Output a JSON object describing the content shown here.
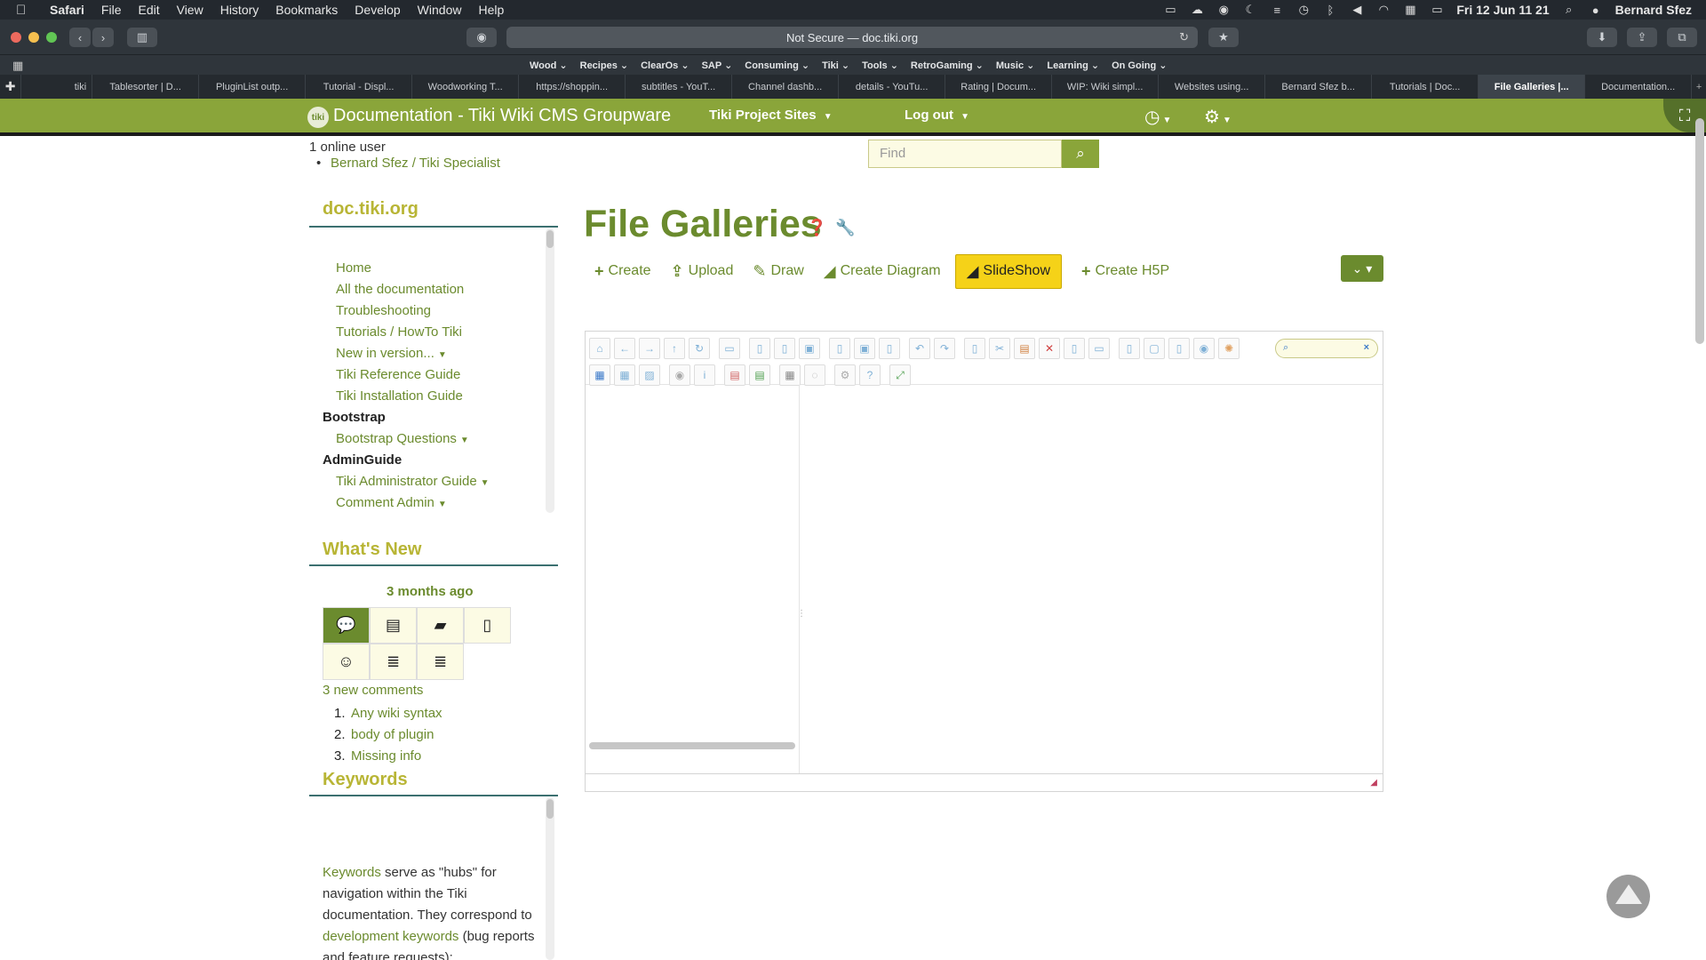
{
  "menubar": {
    "items": [
      "Safari",
      "File",
      "Edit",
      "View",
      "History",
      "Bookmarks",
      "Develop",
      "Window",
      "Help"
    ],
    "clock": "Fri 12 Jun  11 21",
    "user": "Bernard Sfez"
  },
  "browser": {
    "url_text": "Not Secure — doc.tiki.org"
  },
  "bookmarks": [
    "Wood",
    "Recipes",
    "ClearOs",
    "SAP",
    "Consuming",
    "Tiki",
    "Tools",
    "RetroGaming",
    "Music",
    "Learning",
    "On Going"
  ],
  "tabs": [
    {
      "title": "tiki"
    },
    {
      "title": "Tablesorter | D..."
    },
    {
      "title": "PluginList outp..."
    },
    {
      "title": "Tutorial - Displ..."
    },
    {
      "title": "Woodworking T..."
    },
    {
      "title": "https://shoppin..."
    },
    {
      "title": "subtitles - YouT..."
    },
    {
      "title": "Channel dashb..."
    },
    {
      "title": "details - YouTu..."
    },
    {
      "title": "Rating | Docum..."
    },
    {
      "title": "WIP: Wiki simpl..."
    },
    {
      "title": "Websites using..."
    },
    {
      "title": "Bernard Sfez b..."
    },
    {
      "title": "Tutorials | Doc..."
    },
    {
      "title": "File Galleries |..."
    },
    {
      "title": "Documentation..."
    }
  ],
  "header": {
    "logo_text": "tiki",
    "title": "Documentation - Tiki Wiki CMS Groupware",
    "project_sites": "Tiki Project Sites",
    "logout": "Log out"
  },
  "online": {
    "count_text": "1 online user",
    "user": "Bernard Sfez / Tiki Specialist"
  },
  "search": {
    "placeholder": "Find"
  },
  "sidebar": {
    "title": "doc.tiki.org",
    "items": [
      {
        "label": "Home"
      },
      {
        "label": "All the documentation"
      },
      {
        "label": "Troubleshooting"
      },
      {
        "label": "Tutorials / HowTo Tiki"
      },
      {
        "label": "New in version..."
      },
      {
        "label": "Tiki Reference Guide"
      },
      {
        "label": "Tiki Installation Guide"
      },
      {
        "label": "Bootstrap"
      },
      {
        "label": "Bootstrap Questions"
      },
      {
        "label": "AdminGuide"
      },
      {
        "label": "Tiki Administrator Guide"
      },
      {
        "label": "Comment Admin"
      }
    ]
  },
  "whats_new": {
    "title": "What's New",
    "ago": "3 months ago",
    "new_comments": "3 new comments",
    "comments": [
      {
        "num": "1.",
        "label": "Any wiki syntax"
      },
      {
        "num": "2.",
        "label": "body of plugin"
      },
      {
        "num": "3.",
        "label": "Missing info"
      }
    ]
  },
  "keywords": {
    "title": "Keywords",
    "link1": "Keywords",
    "text1": " serve as \"hubs\" for navigation within the Tiki documentation. They correspond to ",
    "link2": "development keywords",
    "text2": " (bug reports and feature requests):"
  },
  "main": {
    "title": "File Galleries",
    "actions": {
      "create": "Create",
      "upload": "Upload",
      "draw": "Draw",
      "create_diagram": "Create Diagram",
      "slideshow": "SlideShow",
      "create_h5p": "Create H5P"
    }
  },
  "colors": {
    "brand_green": "#8aa53a",
    "link_green": "#6b8b2e",
    "heading_olive": "#b8b535",
    "slideshow_yellow": "#f5d218"
  }
}
